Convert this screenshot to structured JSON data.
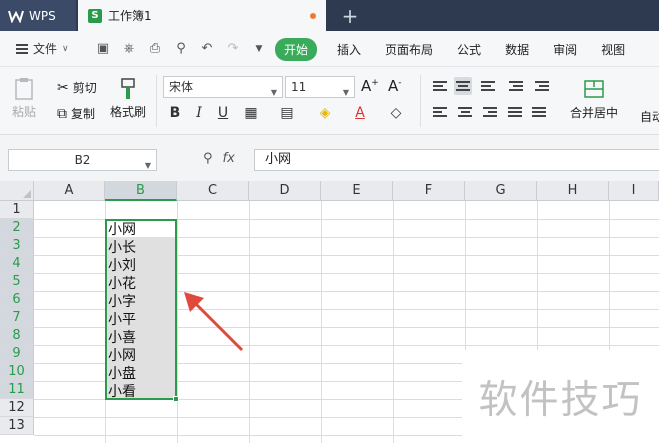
{
  "app": {
    "name": "WPS",
    "document_tab": "工作簿1",
    "new_tab_symbol": "+"
  },
  "menu": {
    "file": "文件",
    "tabs": [
      "开始",
      "插入",
      "页面布局",
      "公式",
      "数据",
      "审阅",
      "视图"
    ],
    "active_tab": "开始"
  },
  "ribbon": {
    "paste": "粘贴",
    "cut": "剪切",
    "copy": "复制",
    "format_painter": "格式刷",
    "font_name": "宋体",
    "font_size": "11",
    "merge_center": "合并居中",
    "auto_wrap_partial": "自动"
  },
  "formula_bar": {
    "name_box": "B2",
    "fx": "fx",
    "content": "小网"
  },
  "sheet": {
    "columns": [
      "A",
      "B",
      "C",
      "D",
      "E",
      "F",
      "G",
      "H",
      "I"
    ],
    "selected_column": "B",
    "rows": [
      "1",
      "2",
      "3",
      "4",
      "5",
      "6",
      "7",
      "8",
      "9",
      "10",
      "11",
      "12",
      "13"
    ],
    "selected_rows": [
      "2",
      "3",
      "4",
      "5",
      "6",
      "7",
      "8",
      "9",
      "10",
      "11"
    ],
    "column_b_values": [
      "小网",
      "小长",
      "小刘",
      "小花",
      "小字",
      "小平",
      "小喜",
      "小网",
      "小盘",
      "小看"
    ]
  },
  "watermark": "软件技巧",
  "colors": {
    "accent_green": "#2a9b4a",
    "annotation_arrow": "#e04a3c",
    "titlebar": "#2d3a4f"
  }
}
